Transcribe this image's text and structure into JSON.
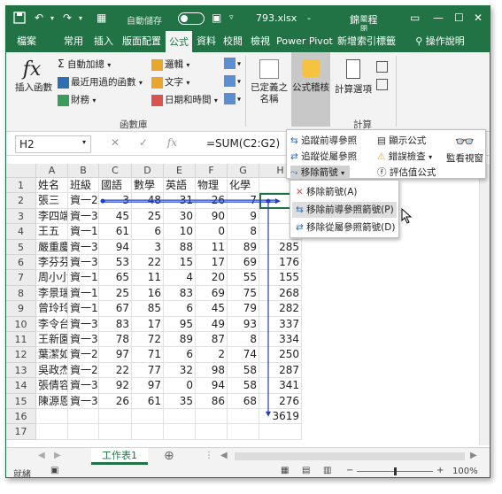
{
  "titlebar": {
    "autosave_label": "自動儲存",
    "autosave_state": "關閉",
    "filename": "793.xlsx",
    "filename_sep": "-",
    "app_name": "錦 程"
  },
  "tabs": [
    "檔案",
    "常用",
    "插入",
    "版面配置",
    "公式",
    "資料",
    "校閱",
    "檢視",
    "Power Pivot",
    "新增索引標籤",
    "操作說明"
  ],
  "ribbon": {
    "insert_function": "插入函數",
    "autosum": "自動加總",
    "recent": "最近用過的函數",
    "financial": "財務",
    "logical": "邏輯",
    "text": "文字",
    "datetime": "日期和時間",
    "library_label": "函數庫",
    "defined_names": "已定義之名稱",
    "formula_audit": "公式稽核",
    "calc_options": "計算選項",
    "calc_label": "計算"
  },
  "formula_bar": {
    "name_box": "H2",
    "formula": "=SUM(C2:G2)"
  },
  "columns": [
    "A",
    "B",
    "C",
    "D",
    "E",
    "F",
    "G",
    "H"
  ],
  "header_row": [
    "姓名",
    "班級",
    "國語",
    "數學",
    "英語",
    "物理",
    "化學"
  ],
  "rows": [
    [
      "張三",
      "資一2",
      "3",
      "48",
      "31",
      "26",
      "7",
      ""
    ],
    [
      "李四端",
      "資一3",
      "45",
      "25",
      "30",
      "90",
      "9",
      ""
    ],
    [
      "王五",
      "資一1",
      "61",
      "6",
      "10",
      "0",
      "8",
      ""
    ],
    [
      "嚴重慶",
      "資一3",
      "94",
      "3",
      "88",
      "11",
      "89",
      "285"
    ],
    [
      "李芬芬",
      "資一3",
      "53",
      "22",
      "15",
      "17",
      "69",
      "176"
    ],
    [
      "周小小",
      "資一1",
      "65",
      "11",
      "4",
      "20",
      "55",
      "155"
    ],
    [
      "李景瑞",
      "資一1",
      "25",
      "16",
      "83",
      "69",
      "75",
      "268"
    ],
    [
      "曾玲玲",
      "資一1",
      "67",
      "85",
      "6",
      "45",
      "79",
      "282"
    ],
    [
      "李令台",
      "資一3",
      "83",
      "17",
      "95",
      "49",
      "93",
      "337"
    ],
    [
      "王新園",
      "資一3",
      "78",
      "72",
      "89",
      "87",
      "8",
      "334"
    ],
    [
      "葉潔如",
      "資一2",
      "97",
      "71",
      "6",
      "2",
      "74",
      "250"
    ],
    [
      "吳政杰",
      "資一2",
      "22",
      "77",
      "32",
      "98",
      "58",
      "287"
    ],
    [
      "張倩容",
      "資一3",
      "92",
      "97",
      "0",
      "94",
      "58",
      "341"
    ],
    [
      "陳源恩",
      "資一3",
      "26",
      "61",
      "35",
      "86",
      "68",
      "276"
    ],
    [
      "",
      "",
      "",
      "",
      "",
      "",
      "",
      "3619"
    ],
    [
      "",
      "",
      "",
      "",
      "",
      "",
      "",
      ""
    ]
  ],
  "audit_panel": {
    "trace_precedents": "追蹤前導參照",
    "trace_dependents": "追蹤從屬參照",
    "remove_arrows": "移除箭號",
    "show_formulas": "顯示公式",
    "error_checking": "錯誤檢查",
    "evaluate": "評估值公式",
    "watch_window": "監看視窗"
  },
  "dropdown": {
    "item1": "移除箭號(A)",
    "item2": "移除前導參照箭號(P)",
    "item3": "移除從屬參照箭號(D)"
  },
  "sheetbar": {
    "sheet_name": "工作表1"
  },
  "statusbar": {
    "status": "就緒",
    "zoom": "100%"
  },
  "colors": {
    "excel_green": "#217346",
    "arrow_blue": "#1f3ec4"
  }
}
